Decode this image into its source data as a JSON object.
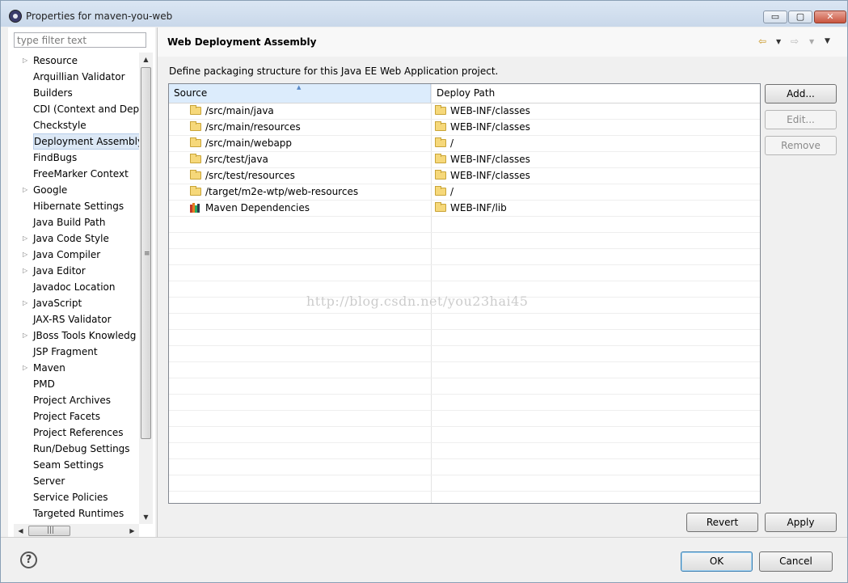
{
  "window": {
    "title": "Properties for maven-you-web",
    "controls": {
      "minimize": "▭",
      "maximize": "▢",
      "close": "✕"
    }
  },
  "sidebar": {
    "filter_placeholder": "type filter text",
    "items": [
      {
        "label": "Resource",
        "expandable": true
      },
      {
        "label": "Arquillian Validator",
        "expandable": false
      },
      {
        "label": "Builders",
        "expandable": false
      },
      {
        "label": "CDI (Context and Dep",
        "expandable": false
      },
      {
        "label": "Checkstyle",
        "expandable": false
      },
      {
        "label": "Deployment Assembly",
        "expandable": false,
        "selected": true
      },
      {
        "label": "FindBugs",
        "expandable": false
      },
      {
        "label": "FreeMarker Context",
        "expandable": false
      },
      {
        "label": "Google",
        "expandable": true
      },
      {
        "label": "Hibernate Settings",
        "expandable": false
      },
      {
        "label": "Java Build Path",
        "expandable": false
      },
      {
        "label": "Java Code Style",
        "expandable": true
      },
      {
        "label": "Java Compiler",
        "expandable": true
      },
      {
        "label": "Java Editor",
        "expandable": true
      },
      {
        "label": "Javadoc Location",
        "expandable": false
      },
      {
        "label": "JavaScript",
        "expandable": true
      },
      {
        "label": "JAX-RS Validator",
        "expandable": false
      },
      {
        "label": "JBoss Tools Knowledg",
        "expandable": true
      },
      {
        "label": "JSP Fragment",
        "expandable": false
      },
      {
        "label": "Maven",
        "expandable": true
      },
      {
        "label": "PMD",
        "expandable": false
      },
      {
        "label": "Project Archives",
        "expandable": false
      },
      {
        "label": "Project Facets",
        "expandable": false
      },
      {
        "label": "Project References",
        "expandable": false
      },
      {
        "label": "Run/Debug Settings",
        "expandable": false
      },
      {
        "label": "Seam Settings",
        "expandable": false
      },
      {
        "label": "Server",
        "expandable": false
      },
      {
        "label": "Service Policies",
        "expandable": false
      },
      {
        "label": "Targeted Runtimes",
        "expandable": false
      }
    ],
    "scroll_glyphs": {
      "up": "▲",
      "down": "▼",
      "left": "◀",
      "right": "▶",
      "grip_v": "≡",
      "grip_h": "|||"
    }
  },
  "page": {
    "title": "Web Deployment Assembly",
    "nav": {
      "back_icon": "⇦",
      "back_menu": "▼",
      "forward_icon": "⇨",
      "forward_menu": "▼",
      "view_menu": "▼"
    },
    "description": "Define packaging structure for this Java EE Web Application project.",
    "table": {
      "columns": [
        "Source",
        "Deploy Path"
      ],
      "sort_indicator": "▲",
      "rows": [
        {
          "source": "/src/main/java",
          "source_icon": "folder-icon",
          "path": "WEB-INF/classes"
        },
        {
          "source": "/src/main/resources",
          "source_icon": "folder-icon",
          "path": "WEB-INF/classes"
        },
        {
          "source": "/src/main/webapp",
          "source_icon": "folder-icon",
          "path": "/"
        },
        {
          "source": "/src/test/java",
          "source_icon": "folder-icon",
          "path": "WEB-INF/classes"
        },
        {
          "source": "/src/test/resources",
          "source_icon": "folder-icon",
          "path": "WEB-INF/classes"
        },
        {
          "source": "/target/m2e-wtp/web-resources",
          "source_icon": "folder-icon",
          "path": "/"
        },
        {
          "source": "Maven Dependencies",
          "source_icon": "library-icon",
          "path": "WEB-INF/lib"
        }
      ],
      "empty_rows": 18
    },
    "buttons": {
      "add": "Add...",
      "edit": "Edit...",
      "remove": "Remove",
      "revert": "Revert",
      "apply": "Apply"
    },
    "watermark": "http://blog.csdn.net/you23hai45"
  },
  "footer": {
    "help": "?",
    "ok": "OK",
    "cancel": "Cancel"
  }
}
